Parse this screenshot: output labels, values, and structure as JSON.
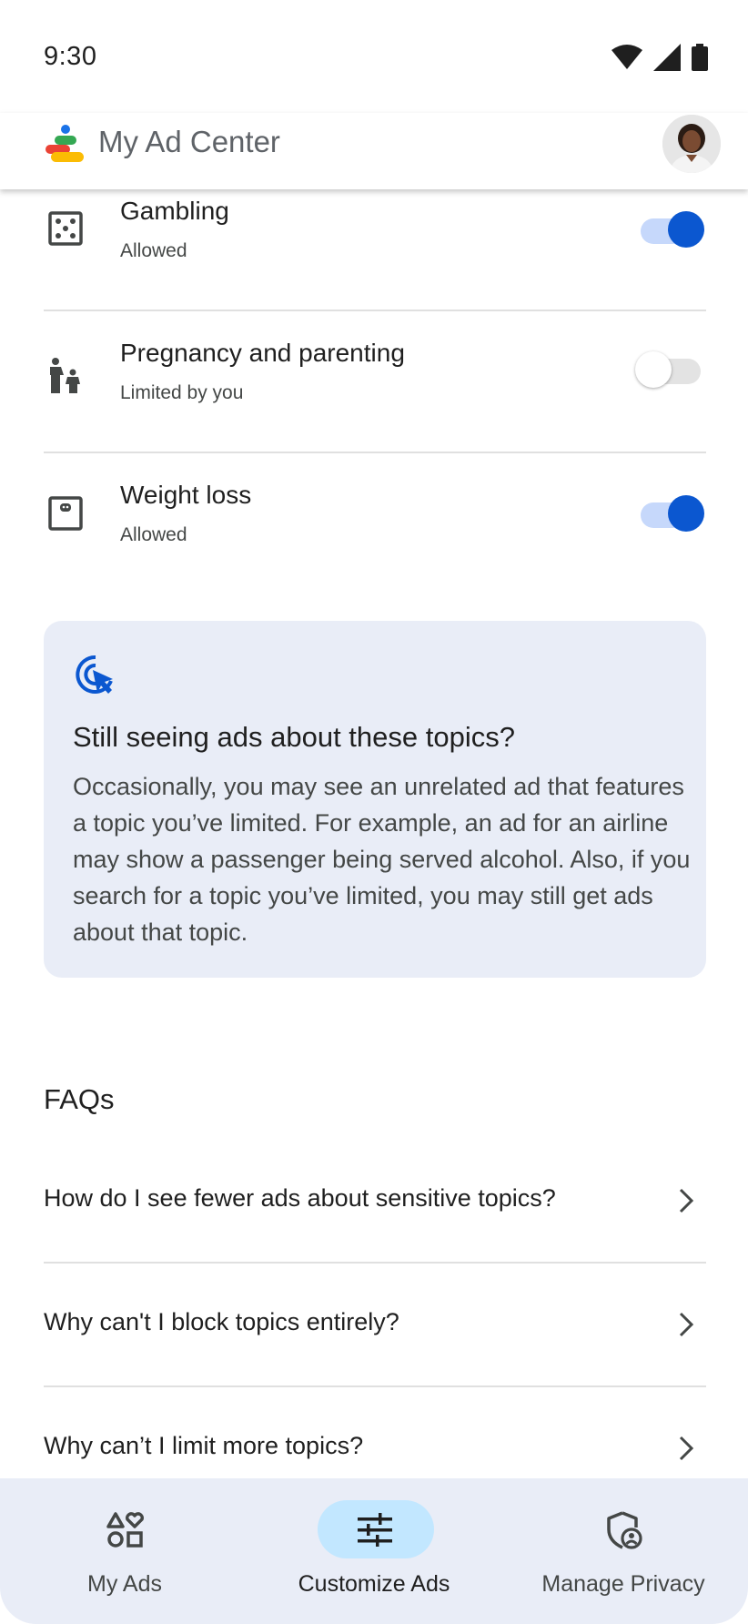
{
  "status_bar": {
    "time": "9:30",
    "icons": [
      "wifi-icon",
      "signal-icon",
      "battery-icon"
    ]
  },
  "app_bar": {
    "title": "My Ad Center",
    "logo_icon": "ad-center-logo",
    "avatar_icon": "profile-avatar"
  },
  "topics": [
    {
      "title": "Gambling",
      "status": "Allowed",
      "icon": "dice-icon",
      "enabled": true
    },
    {
      "title": "Pregnancy and parenting",
      "status": "Limited by you",
      "icon": "parent-child-icon",
      "enabled": false
    },
    {
      "title": "Weight loss",
      "status": "Allowed",
      "icon": "scale-icon",
      "enabled": true
    }
  ],
  "info_card": {
    "icon": "cursor-click-icon",
    "title": "Still seeing ads about these topics?",
    "body": "Occasionally, you may see an unrelated ad that features a topic you’ve limited. For example, an ad for an airline may show a passenger being served alcohol. Also, if you search for a topic you’ve limited, you may still get ads about that topic."
  },
  "faqs": {
    "heading": "FAQs",
    "items": [
      {
        "question": "How do I see fewer ads about sensitive topics?"
      },
      {
        "question": "Why can't I block topics entirely?"
      },
      {
        "question": "Why can’t I limit more topics?"
      }
    ]
  },
  "bottom_nav": {
    "items": [
      {
        "label": "My Ads",
        "icon": "shapes-heart-icon",
        "active": false
      },
      {
        "label": "Customize Ads",
        "icon": "tune-icon",
        "active": true
      },
      {
        "label": "Manage Privacy",
        "icon": "shield-person-icon",
        "active": false
      }
    ]
  },
  "colors": {
    "accent": "#0b57d0",
    "toggle_track_on": "#c6d8fb",
    "card_background": "#e9edf7",
    "nav_active_pill": "#c2e7ff"
  }
}
